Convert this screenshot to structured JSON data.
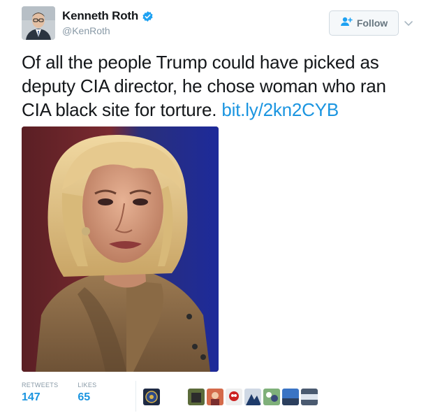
{
  "author": {
    "display_name": "Kenneth Roth",
    "handle": "@KenRoth",
    "verified_icon": "verified-badge-icon"
  },
  "follow_button": {
    "label": "Follow",
    "icon": "add-user-icon"
  },
  "tweet": {
    "text": "Of all the people Trump could have picked as deputy CIA director, he chose woman who ran CIA black site for torture.",
    "link": "bit.ly/2kn2CYB"
  },
  "stats": {
    "retweets_label": "RETWEETS",
    "retweets_value": "147",
    "likes_label": "LIKES",
    "likes_value": "65"
  },
  "colors": {
    "link": "#1b95e0",
    "text": "#14171a",
    "muted": "#8899a6",
    "verified": "#1da1f2"
  }
}
